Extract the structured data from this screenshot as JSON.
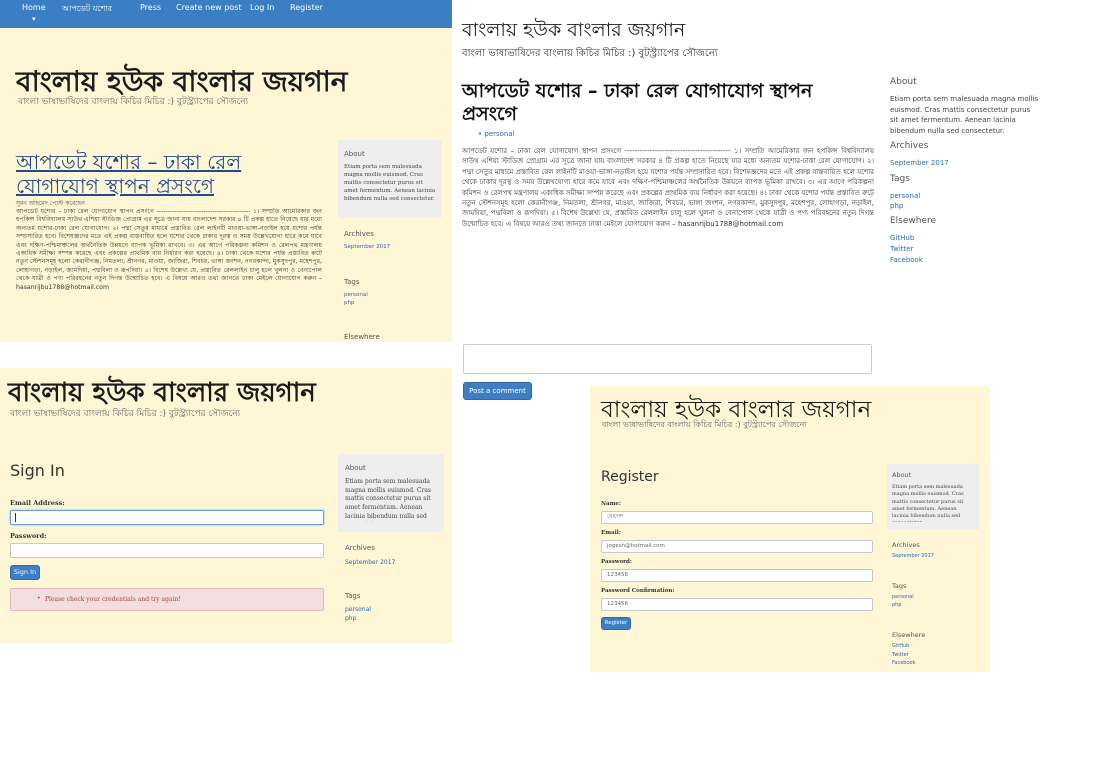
{
  "site": {
    "title": "বাংলায় হউক বাংলার জয়গান",
    "tagline": "বাংলা ভাষাভাষিদের বাংলায় কিচির মিচির :) বুটস্ট্র্যাপের সৌজন্যে"
  },
  "navbar": {
    "items": [
      "Home",
      "আপডেট যশোর",
      "Press",
      "Create new post",
      "Log In",
      "Register"
    ]
  },
  "post": {
    "title": "আপডেট যশোর – ঢাকা রেল যোগাযোগ স্থাপন প্রসংগে",
    "tag": "personal",
    "meta": "সুমন আহমেদ পোস্ট করেছেন",
    "body": "আপডেট যশোর – ঢাকা রেল যোগাযোগ স্থাপন প্রসংগে ------------------------------------------ ১। সম্প্রতি আমেরিকার জন হপকিন্স বিশ্ববিদ্যালয় সাউথ এশিয়া স্টাডিজ প্রোগ্রাম এর সূত্রে জানা যায় বাংলাদেশ সরকার ৪ টি প্রকল্প হাতে নিয়েছে যার মধ্যে অন্যতম যশোর-ঢাকা রেল যোগাযোগ। ২। পদ্মা সেতুর মাধ্যমে প্রস্তাবিত রেল লাইনটি মাওয়া-ভাঙ্গা-নড়াইল হয়ে যশোর পর্যন্ত সম্প্রসারিত হবে। বিশেষজ্ঞদের মতে এই প্রকল্প বাস্তবায়িত হলে যশোর থেকে ঢাকার দূরত্ব ও সময় উল্লেখযোগ্য হারে কমে যাবে এবং দক্ষিণ-পশ্চিমাঞ্চলের অর্থনৈতিক উন্নয়নে ব্যাপক ভূমিকা রাখবে। ৩। এর আগে পরিকল্পনা কমিশন ও রেলপথ মন্ত্রণালয় একাধিক সমীক্ষা সম্পন্ন করেছে এবং প্রকল্পের প্রাথমিক ব্যয় নির্ধারণ করা হয়েছে। ৪। ঢাকা থেকে যশোর পর্যন্ত প্রস্তাবিত রুটে নতুন স্টেশনসমূহ হলো কেরানীগঞ্জ, নিমতলা, শ্রীনগর, মাওয়া, জাজিরা, শিবচর, ভাঙ্গা জংশন, নগরকান্দা, মুকসুদপুর, মহেশপুর, লোহাগড়া, নড়াইল, জামদিয়া, পদ্মবিলা ও রূপদিয়া। ৫। বিশেষ উল্লেখ্য যে, প্রস্তাবিত রেললাইন চালু হলে খুলনা ও বেনাপোল থেকে যাত্রী ও পণ্য পরিবহনের নতুন দিগন্ত উন্মোচিত হবে। এ বিষয়ে আরও তথ্য জানতে ঢাকা মেইলে যোগাযোগ করুন – hasanrijbu1788@hotmail.com"
  },
  "sidebar": {
    "about_heading": "About",
    "about_text": "Etiam porta sem malesuada magna mollis euismod. Cras mattis consectetur purus sit amet fermentum. Aenean lacinia bibendum nulla sed consectetur.",
    "archives_heading": "Archives",
    "archive_link": "September 2017",
    "tags_heading": "Tags",
    "tags": [
      "personal",
      "php"
    ],
    "elsewhere_heading": "Elsewhere",
    "elsewhere": [
      "GitHub",
      "Twitter",
      "Facebook"
    ]
  },
  "comment": {
    "placeholder": "",
    "button": "Post a comment"
  },
  "signin": {
    "heading": "Sign In",
    "email_label": "Email Address:",
    "email_value": "",
    "password_label": "Password:",
    "password_value": "",
    "button": "Sign In",
    "error": "Please check your credentials and try again!"
  },
  "register": {
    "heading": "Register",
    "name_label": "Name:",
    "name_value": "যোগেশ",
    "email_label": "Email:",
    "email_value": "jogesh@hotmail.com",
    "password_label": "Password:",
    "password_value": "123456",
    "confirm_label": "Password Confirmation:",
    "confirm_value": "123456",
    "button": "Register"
  },
  "colors": {
    "cream": "#fff6d6",
    "navbar": "#3a7fc4",
    "link": "#2a6ab5",
    "error_bg": "#f2dede"
  }
}
